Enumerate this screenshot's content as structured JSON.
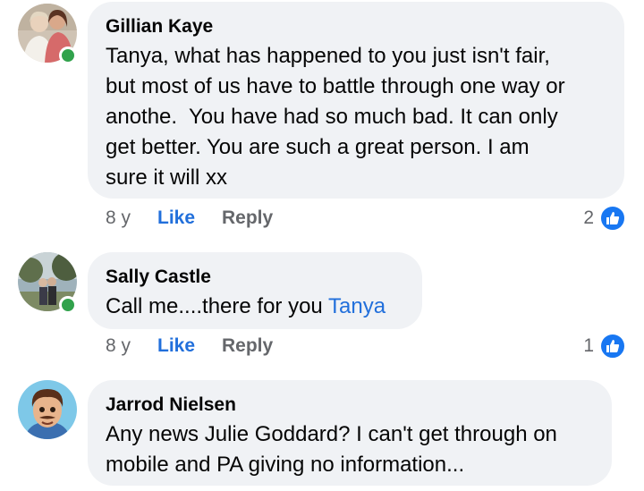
{
  "comments": [
    {
      "author": "Gillian Kaye",
      "lines": [
        "Tanya, what has happened to you just isn't fair,",
        "but most of us have to battle through one way or",
        "anothe.  You have had so much bad. It can only",
        "get better. You are such a great person. I am",
        "sure it will xx"
      ],
      "online": true,
      "time": "8 y",
      "like_label": "Like",
      "reply_label": "Reply",
      "reaction_count": "2",
      "avatar_icon": "profile-photo-two-women"
    },
    {
      "author": "Sally Castle",
      "text_before": "Call me....there for you ",
      "mention": "Tanya",
      "online": true,
      "time": "8 y",
      "like_label": "Like",
      "reply_label": "Reply",
      "reaction_count": "1",
      "avatar_icon": "profile-photo-outdoor-couple"
    },
    {
      "author": "Jarrod Nielsen",
      "lines": [
        "Any news Julie Goddard? I can't get through on",
        "mobile and PA giving no information..."
      ],
      "online": false,
      "avatar_icon": "profile-cartoon-man"
    }
  ],
  "colors": {
    "bubble": "#f0f2f5",
    "link_blue": "#216fdb",
    "like_badge": "#1877f2",
    "online": "#31a24c",
    "meta_gray": "#65676b"
  }
}
